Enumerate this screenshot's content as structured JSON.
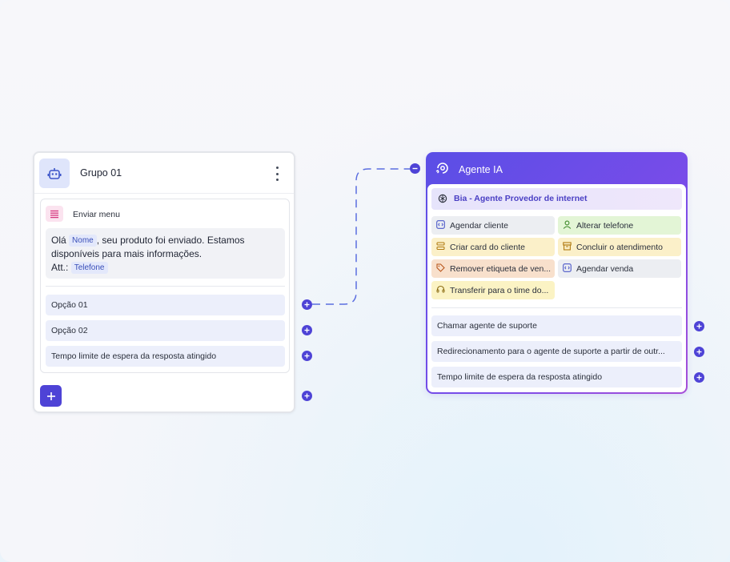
{
  "group": {
    "title": "Grupo 01",
    "menu_label": "Enviar menu",
    "message": {
      "part1": "Olá",
      "tag_name": "Nome",
      "part2": ", seu produto foi enviado. Estamos disponíveis para mais informações.",
      "att_label": "Att.:",
      "tag_phone": "Telefone"
    },
    "options": [
      {
        "label": "Opção 01"
      },
      {
        "label": "Opção 02"
      },
      {
        "label": "Tempo limite de espera da resposta atingido"
      }
    ]
  },
  "agent": {
    "title": "Agente IA",
    "bia_label": "Bia - Agente Provedor de internet",
    "tools": [
      {
        "label": "Agendar cliente",
        "icon": "code-square-icon",
        "color": "#eceef2"
      },
      {
        "label": "Alterar telefone",
        "icon": "user-icon",
        "color": "#e3f5d6"
      },
      {
        "label": "Criar card do cliente",
        "icon": "stack-icon",
        "color": "#fbf0c9"
      },
      {
        "label": "Concluir o atendimento",
        "icon": "archive-icon",
        "color": "#fbf0c9"
      },
      {
        "label": "Remover etiqueta de ven...",
        "icon": "tag-icon",
        "color": "#f8e0cc"
      },
      {
        "label": "Agendar venda",
        "icon": "code-square-icon",
        "color": "#eceef2"
      },
      {
        "label": "Transferir para o time do...",
        "icon": "headset-icon",
        "color": "#fbf3c4"
      }
    ],
    "options": [
      {
        "label": "Chamar agente de suporte"
      },
      {
        "label": "Redirecionamento para o agente de suporte a partir de outr..."
      },
      {
        "label": "Tempo limite de espera da resposta atingido"
      }
    ]
  },
  "colors": {
    "accent": "#4e43d6",
    "agent_gradient_start": "#5a4ee6",
    "agent_gradient_end": "#a64ed8"
  }
}
